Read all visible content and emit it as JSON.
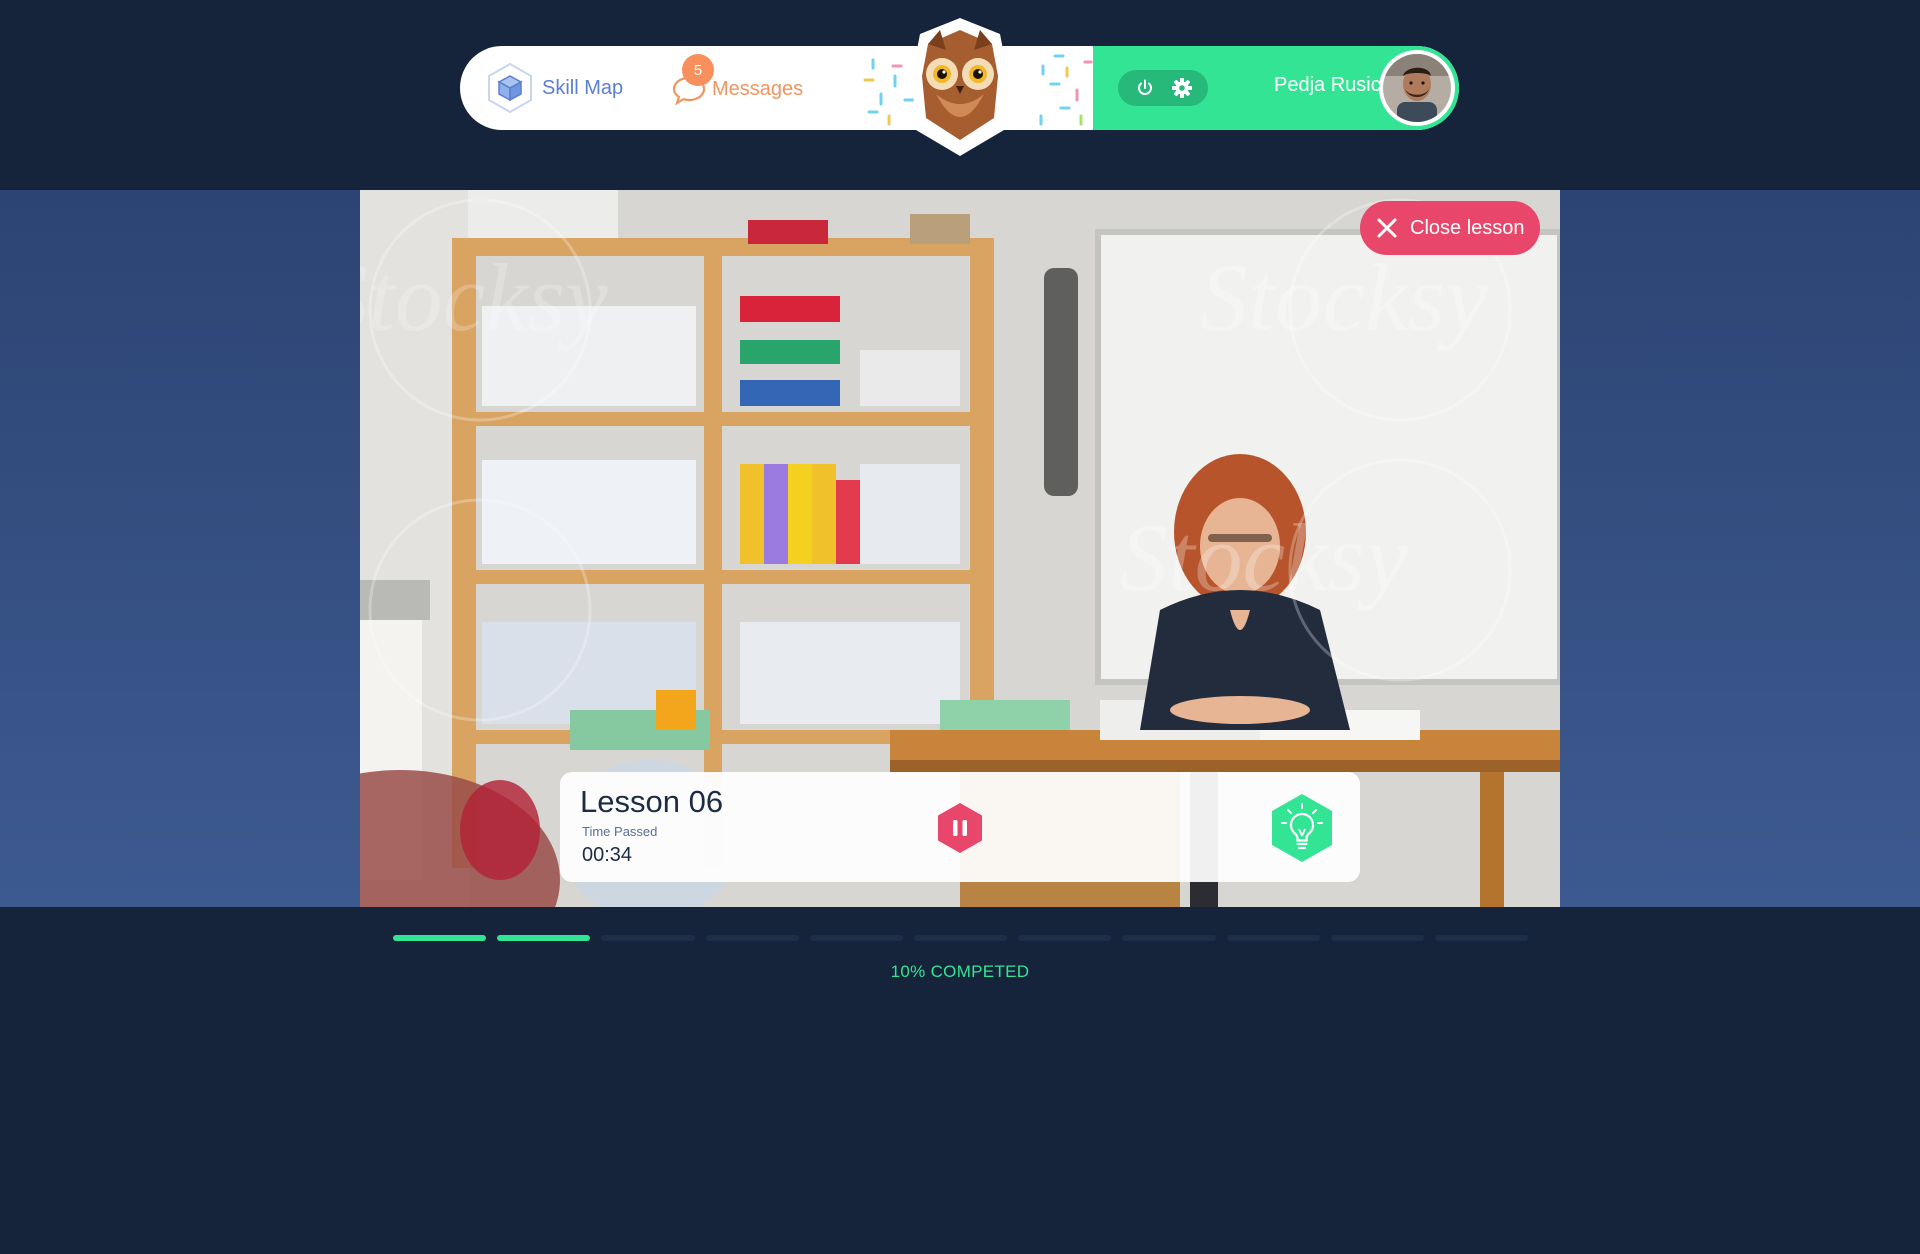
{
  "header": {
    "skill_map_label": "Skill Map",
    "messages_label": "Messages",
    "messages_count": "5",
    "user_name": "Pedja Rusic"
  },
  "lesson": {
    "close_label": "Close lesson",
    "title": "Lesson 06",
    "time_label": "Time Passed",
    "time_value": "00:34"
  },
  "progress": {
    "segments_total": 11,
    "segments_done": 2,
    "label": "10% COMPETED"
  },
  "watermark": "Stocksy",
  "colors": {
    "background": "#15233b",
    "accent_green": "#33e494",
    "accent_red": "#e8466a",
    "accent_orange": "#f7905c",
    "accent_blue": "#5b7fd0"
  },
  "icons": {
    "skill_map": "cube-icon",
    "messages": "chat-bubble-icon",
    "power": "power-icon",
    "settings": "gear-icon",
    "close": "close-icon",
    "pause": "pause-icon",
    "hint": "lightbulb-icon"
  }
}
